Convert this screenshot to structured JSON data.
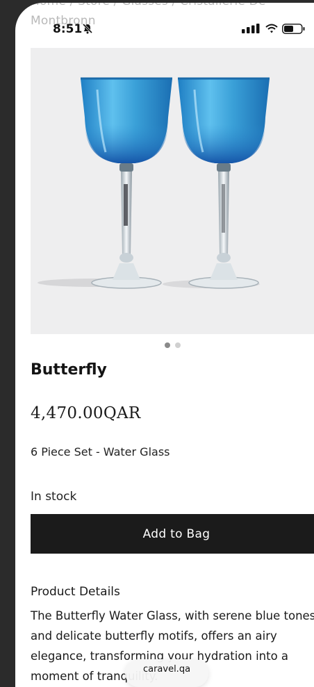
{
  "breadcrumb": {
    "line1": "Home  /  Store  /  Glasses  /  Cristallerie De",
    "line2": "Montbronn"
  },
  "status_bar": {
    "time": "8:51",
    "icons": [
      "bell-slash-icon",
      "signal-icon",
      "wifi-icon",
      "battery-icon"
    ]
  },
  "gallery": {
    "image_alt": "Two blue Butterfly water glasses",
    "slide_count": 2,
    "active_slide": 1
  },
  "product": {
    "name": "Butterfly",
    "price": "4,470.00QAR",
    "variant": "6 Piece Set - Water Glass",
    "stock": "In stock",
    "add_button": "Add to Bag"
  },
  "details": {
    "heading": "Product Details",
    "text": "The Butterfly Water Glass, with serene blue tones and delicate butterfly motifs, offers an airy elegance, transforming your hydration into a moment of tranquility."
  },
  "browser": {
    "url": "caravel.qa"
  },
  "colors": {
    "background": "#2b2b2b",
    "button": "#1b1b1b",
    "glass_blue": "#3aa0d8"
  }
}
